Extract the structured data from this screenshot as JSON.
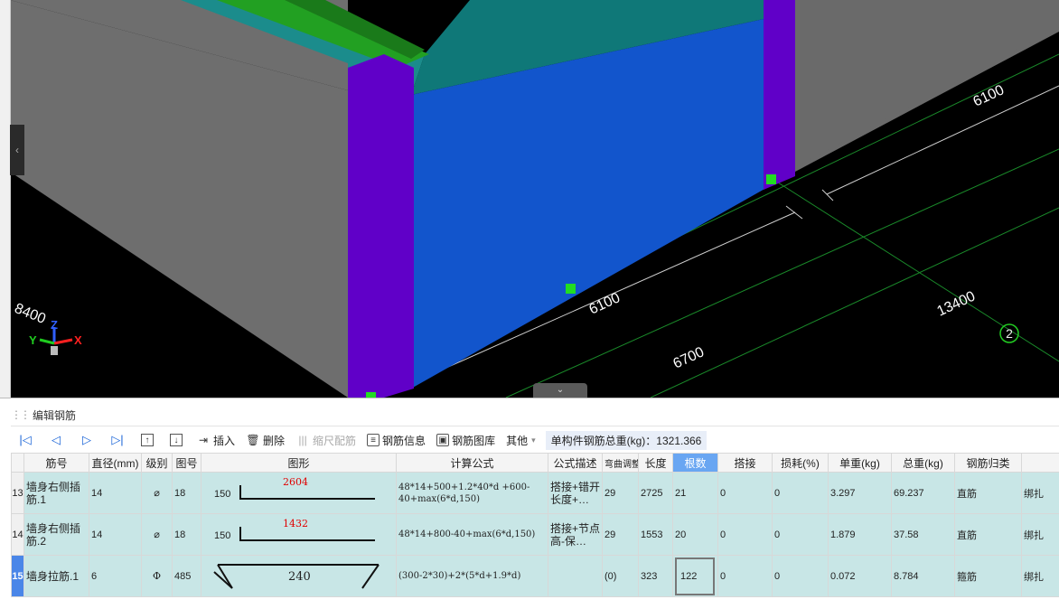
{
  "viewport": {
    "dimension_labels": [
      "6100",
      "6100",
      "6700",
      "13400",
      "8400"
    ],
    "axis_label": "2",
    "axes": {
      "x": "X",
      "y": "Y",
      "z": "Z"
    }
  },
  "panel": {
    "title": "编辑钢筋"
  },
  "toolbar": {
    "insert": "插入",
    "delete": "删除",
    "scale_rebar": "缩尺配筋",
    "rebar_info": "钢筋信息",
    "rebar_library": "钢筋图库",
    "other": "其他",
    "total_weight": "单构件钢筋总重(kg)：1321.366"
  },
  "table": {
    "headers": [
      "筋号",
      "直径(mm)",
      "级别",
      "图号",
      "图形",
      "计算公式",
      "公式描述",
      "弯曲调整",
      "长度",
      "根数",
      "搭接",
      "损耗(%)",
      "单重(kg)",
      "总重(kg)",
      "钢筋归类",
      ""
    ],
    "rows": [
      {
        "idx": "13",
        "name": "墙身右侧插筋.1",
        "dia": "14",
        "grade": "⌀",
        "fig": "18",
        "shape_left": "150",
        "shape_value": "2604",
        "formula": "48*14+500+1.2*40*d +600-40+max(6*d,150)",
        "desc": "搭接+错开长度+…",
        "bend": "29",
        "length": "2725",
        "count": "21",
        "lap": "0",
        "loss": "0",
        "unit_w": "3.297",
        "total_w": "69.237",
        "category": "直筋",
        "join": "绑扎"
      },
      {
        "idx": "14",
        "name": "墙身右侧插筋.2",
        "dia": "14",
        "grade": "⌀",
        "fig": "18",
        "shape_left": "150",
        "shape_value": "1432",
        "formula": "48*14+800-40+max(6*d,150)",
        "desc": "搭接+节点高-保…",
        "bend": "29",
        "length": "1553",
        "count": "20",
        "lap": "0",
        "loss": "0",
        "unit_w": "1.879",
        "total_w": "37.58",
        "category": "直筋",
        "join": "绑扎"
      },
      {
        "idx": "15",
        "name": "墙身拉筋.1",
        "dia": "6",
        "grade": "Φ",
        "fig": "485",
        "shape_value": "240",
        "formula": "(300-2*30)+2*(5*d+1.9*d)",
        "desc": "",
        "bend": "(0)",
        "length": "323",
        "count": "122",
        "lap": "0",
        "loss": "0",
        "unit_w": "0.072",
        "total_w": "8.784",
        "category": "箍筋",
        "join": "绑扎"
      }
    ]
  }
}
